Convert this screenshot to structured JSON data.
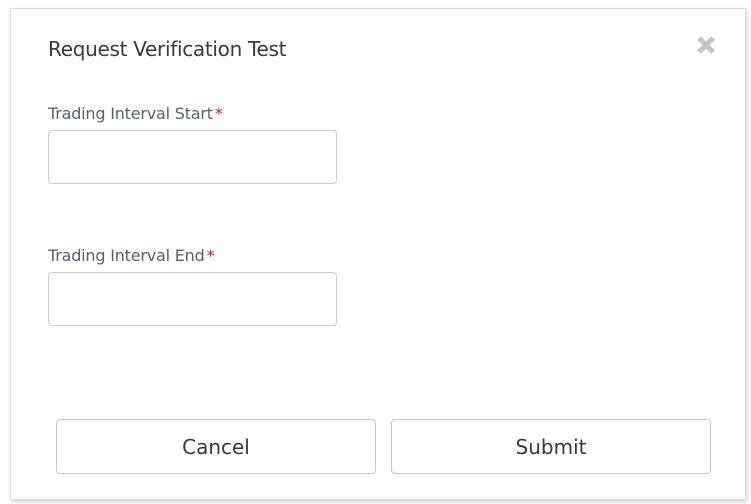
{
  "dialog": {
    "title": "Request Verification Test",
    "close_icon": "close-icon"
  },
  "fields": {
    "start": {
      "label": "Trading Interval Start",
      "required_mark": "*",
      "value": "",
      "placeholder": ""
    },
    "end": {
      "label": "Trading Interval End",
      "required_mark": "*",
      "value": "",
      "placeholder": ""
    }
  },
  "buttons": {
    "cancel_label": "Cancel",
    "submit_label": "Submit"
  },
  "colors": {
    "required": "#b2283a",
    "label": "#55636f",
    "border": "#cccccc"
  }
}
